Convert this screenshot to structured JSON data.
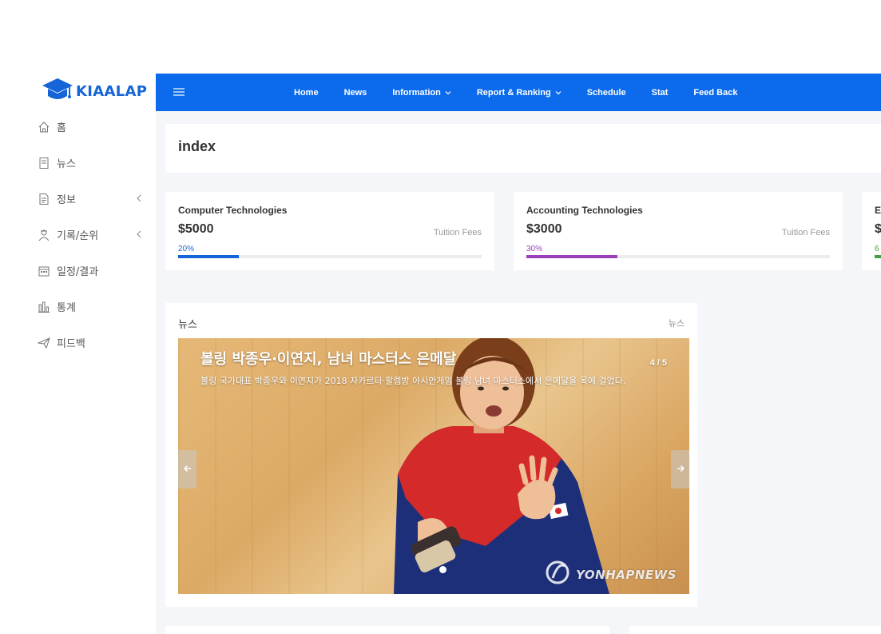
{
  "brand": {
    "name": "KIAALAP",
    "color": "#1565d8"
  },
  "sidebar": {
    "items": [
      {
        "label": "홈",
        "icon": "home-icon",
        "has_children": false
      },
      {
        "label": "뉴스",
        "icon": "news-icon",
        "has_children": false
      },
      {
        "label": "정보",
        "icon": "document-icon",
        "has_children": true
      },
      {
        "label": "기록/순위",
        "icon": "user-ranking-icon",
        "has_children": true
      },
      {
        "label": "일정/결과",
        "icon": "calendar-icon",
        "has_children": false
      },
      {
        "label": "통계",
        "icon": "bar-chart-icon",
        "has_children": false
      },
      {
        "label": "피드백",
        "icon": "send-icon",
        "has_children": false
      }
    ]
  },
  "topnav": {
    "color": "#0b6bec",
    "items": [
      {
        "label": "Home",
        "dropdown": false
      },
      {
        "label": "News",
        "dropdown": false
      },
      {
        "label": "Information",
        "dropdown": true
      },
      {
        "label": "Report & Ranking",
        "dropdown": true
      },
      {
        "label": "Schedule",
        "dropdown": false
      },
      {
        "label": "Stat",
        "dropdown": false
      },
      {
        "label": "Feed Back",
        "dropdown": false
      }
    ]
  },
  "page": {
    "title": "index"
  },
  "stats": [
    {
      "title": "Computer Technologies",
      "amount": "$5000",
      "sub": "Tuition Fees",
      "percent_label": "20%",
      "progress": 0.2,
      "color": "#1565d8"
    },
    {
      "title": "Accounting Technologies",
      "amount": "$3000",
      "sub": "Tuition Fees",
      "percent_label": "30%",
      "progress": 0.3,
      "color": "#9c3fba"
    },
    {
      "title": "E",
      "amount": "$",
      "sub": "",
      "percent_label": "6",
      "progress": 0.6,
      "color": "#43a047"
    }
  ],
  "news": {
    "title": "뉴스",
    "link_label": "뉴스",
    "slide": {
      "title": "볼링 박종우·이연지, 남녀 마스터스 은메달",
      "description": "볼링 국가대표 박종우와 이연지가 2018 자카르타·팔렘방 아시안게임 볼링 남녀 마스터스에서 은메달을 목에 걸었다.",
      "counter": "4 / 5",
      "watermark": "YONHAPNEWS"
    }
  }
}
